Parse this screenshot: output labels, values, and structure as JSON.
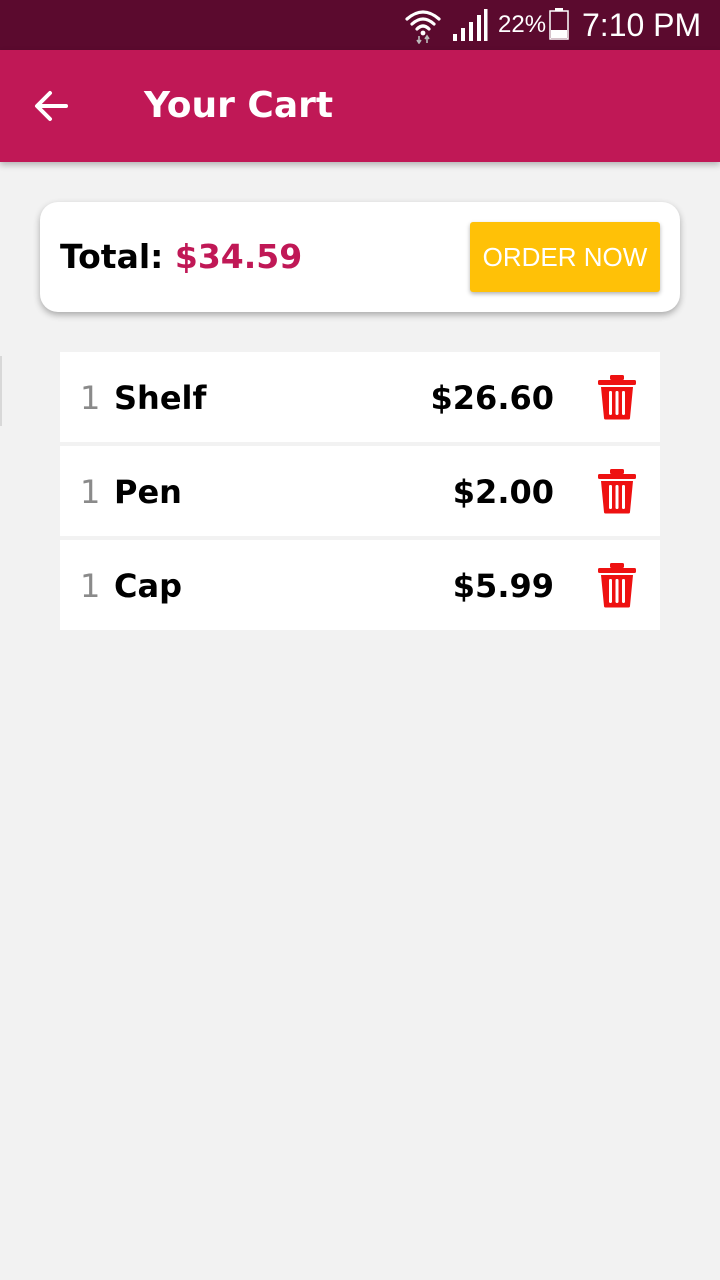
{
  "status_bar": {
    "battery_percent": "22%",
    "time": "7:10 PM",
    "icons": [
      "wifi-icon",
      "signal-icon",
      "battery-icon"
    ]
  },
  "app_bar": {
    "back_icon": "arrow-left-icon",
    "title": "Your Cart"
  },
  "summary": {
    "total_label": "Total:",
    "total_value": "$34.59",
    "order_button_label": "ORDER NOW"
  },
  "cart": {
    "items": [
      {
        "qty": "1",
        "name": "Shelf",
        "price": "$26.60",
        "delete_icon": "trash-icon"
      },
      {
        "qty": "1",
        "name": "Pen",
        "price": "$2.00",
        "delete_icon": "trash-icon"
      },
      {
        "qty": "1",
        "name": "Cap",
        "price": "$5.99",
        "delete_icon": "trash-icon"
      }
    ]
  },
  "colors": {
    "status_bar": "#5b0a2e",
    "primary": "#c01856",
    "accent": "#ffc107",
    "delete": "#ee1111",
    "background": "#f2f2f2"
  }
}
